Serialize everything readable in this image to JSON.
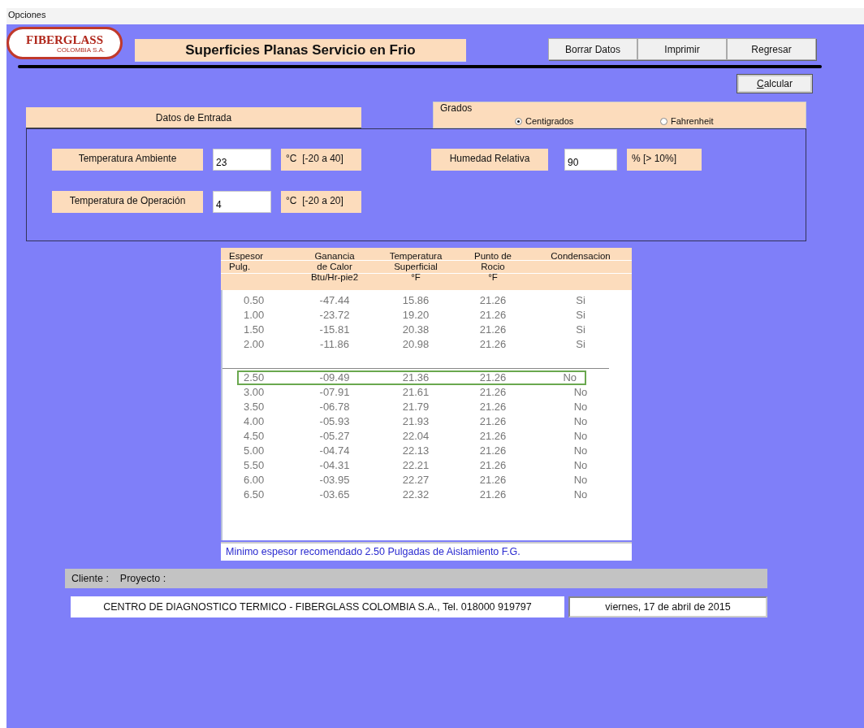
{
  "menu": [
    "Opciones"
  ],
  "logo": {
    "brand": "FIBERGLASS",
    "subtitle": "COLOMBIA S.A."
  },
  "title": "Superficies Planas Servicio en Frio",
  "buttons": [
    "Borrar Datos",
    "Imprimir",
    "Regresar"
  ],
  "calculate_button": "Calcular",
  "input_section": {
    "heading": "Datos de Entrada",
    "units_group": {
      "label": "Grados",
      "options": [
        {
          "label": "Centigrados",
          "selected": true
        },
        {
          "label": "Fahrenheit",
          "selected": false
        }
      ]
    },
    "fields": [
      {
        "label": "Temperatura Ambiente",
        "value": "23",
        "range": "°C  [-20 a 40]"
      },
      {
        "label": "Humedad Relativa",
        "value": "90",
        "range": "% [> 10%]"
      },
      {
        "label": "Temperatura de Operación",
        "value": "4",
        "range": "°C  [-20 a 20]"
      }
    ]
  },
  "results": {
    "columns": [
      {
        "lines": [
          "Espesor",
          "Pulg."
        ]
      },
      {
        "lines": [
          "Ganancia",
          "de  Calor",
          "Btu/Hr-pie2"
        ]
      },
      {
        "lines": [
          "Temperatura",
          "Superficial",
          "°F"
        ]
      },
      {
        "lines": [
          "Punto de",
          "Rocio",
          "°F"
        ]
      },
      {
        "lines": [
          "Condensacion"
        ]
      }
    ],
    "row_groups": [
      [
        {
          "cells": [
            "0.50",
            "-47.44",
            "15.86",
            "21.26",
            "Si"
          ],
          "selected": false
        },
        {
          "cells": [
            "1.00",
            "-23.72",
            "19.20",
            "21.26",
            "Si"
          ],
          "selected": false
        },
        {
          "cells": [
            "1.50",
            "-15.81",
            "20.38",
            "21.26",
            "Si"
          ],
          "selected": false
        },
        {
          "cells": [
            "2.00",
            "-11.86",
            "20.98",
            "21.26",
            "Si"
          ],
          "selected": false
        }
      ],
      [
        {
          "cells": [
            "2.50",
            "-09.49",
            "21.36",
            "21.26",
            "No"
          ],
          "selected": true
        },
        {
          "cells": [
            "3.00",
            "-07.91",
            "21.61",
            "21.26",
            "No"
          ],
          "selected": false
        },
        {
          "cells": [
            "3.50",
            "-06.78",
            "21.79",
            "21.26",
            "No"
          ],
          "selected": false
        },
        {
          "cells": [
            "4.00",
            "-05.93",
            "21.93",
            "21.26",
            "No"
          ],
          "selected": false
        },
        {
          "cells": [
            "4.50",
            "-05.27",
            "22.04",
            "21.26",
            "No"
          ],
          "selected": false
        },
        {
          "cells": [
            "5.00",
            "-04.74",
            "22.13",
            "21.26",
            "No"
          ],
          "selected": false
        },
        {
          "cells": [
            "5.50",
            "-04.31",
            "22.21",
            "21.26",
            "No"
          ],
          "selected": false
        },
        {
          "cells": [
            "6.00",
            "-03.95",
            "22.27",
            "21.26",
            "No"
          ],
          "selected": false
        },
        {
          "cells": [
            "6.50",
            "-03.65",
            "22.32",
            "21.26",
            "No"
          ],
          "selected": false
        }
      ]
    ],
    "recommendation": "Minimo espesor recomendado 2.50 Pulgadas de Aislamiento F.G."
  },
  "client_bar": [
    "Cliente :",
    "Proyecto :"
  ],
  "footer": {
    "company": "CENTRO DE DIAGNOSTICO TERMICO - FIBERGLASS COLOMBIA S.A., Tel. 018000 919797",
    "date": "viernes, 17 de abril de 2015"
  }
}
